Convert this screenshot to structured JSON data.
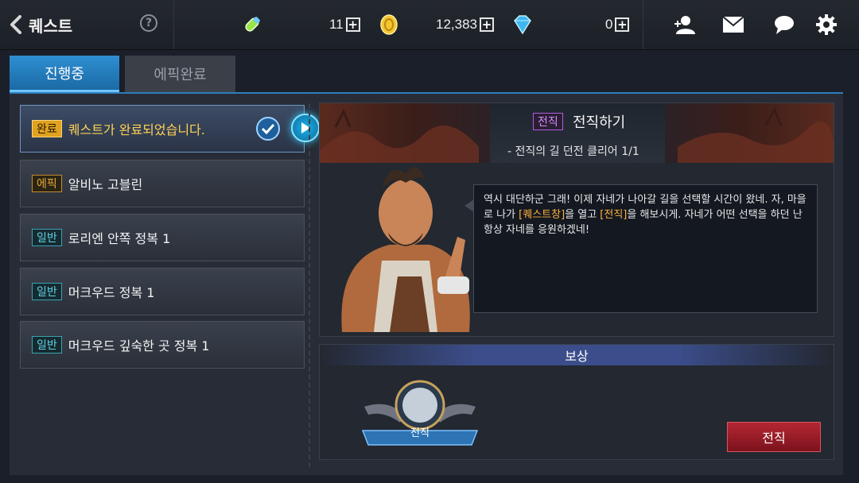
{
  "header": {
    "title": "퀘스트",
    "help": "?",
    "resources": [
      {
        "name": "stamina",
        "value": "11"
      },
      {
        "name": "gold",
        "value": "12,383"
      },
      {
        "name": "gem",
        "value": "0"
      }
    ]
  },
  "tabs": [
    {
      "label": "진행중",
      "active": true
    },
    {
      "label": "에픽완료",
      "active": false
    }
  ],
  "quests": [
    {
      "badge": "완료",
      "name": "퀘스트가 완료되었습니다.",
      "selected": true
    },
    {
      "badge": "에픽",
      "name": "알비노 고블린"
    },
    {
      "badge": "일반",
      "name": "로리엔 안쪽 정복 1"
    },
    {
      "badge": "일반",
      "name": "머크우드 정복 1"
    },
    {
      "badge": "일반",
      "name": "머크우드 깊숙한 곳 정복 1"
    }
  ],
  "detail": {
    "tag": "전직",
    "title": "전직하기",
    "objective": "- 전직의 길 던전 클리어 1/1",
    "dialog": {
      "p1": "역시 대단하군 그래! 이제 자네가 나아갈 길을 선택할 시간이 왔네. 자, 마을로 나가 ",
      "hl1": "[퀘스트창]",
      "p2": "을 열고 ",
      "hl2": "[전직]",
      "p3": "을 해보시게. 자네가 어떤 선택을 하던 난 항상 자네를 응원하겠네!"
    }
  },
  "reward": {
    "header": "보상",
    "item_label": "전직",
    "button": "전직"
  },
  "colors": {
    "accent_blue": "#2f8fd2",
    "complete_gold": "#e0a21f",
    "highlight_orange": "#ffb13b",
    "button_red": "#b42733"
  }
}
